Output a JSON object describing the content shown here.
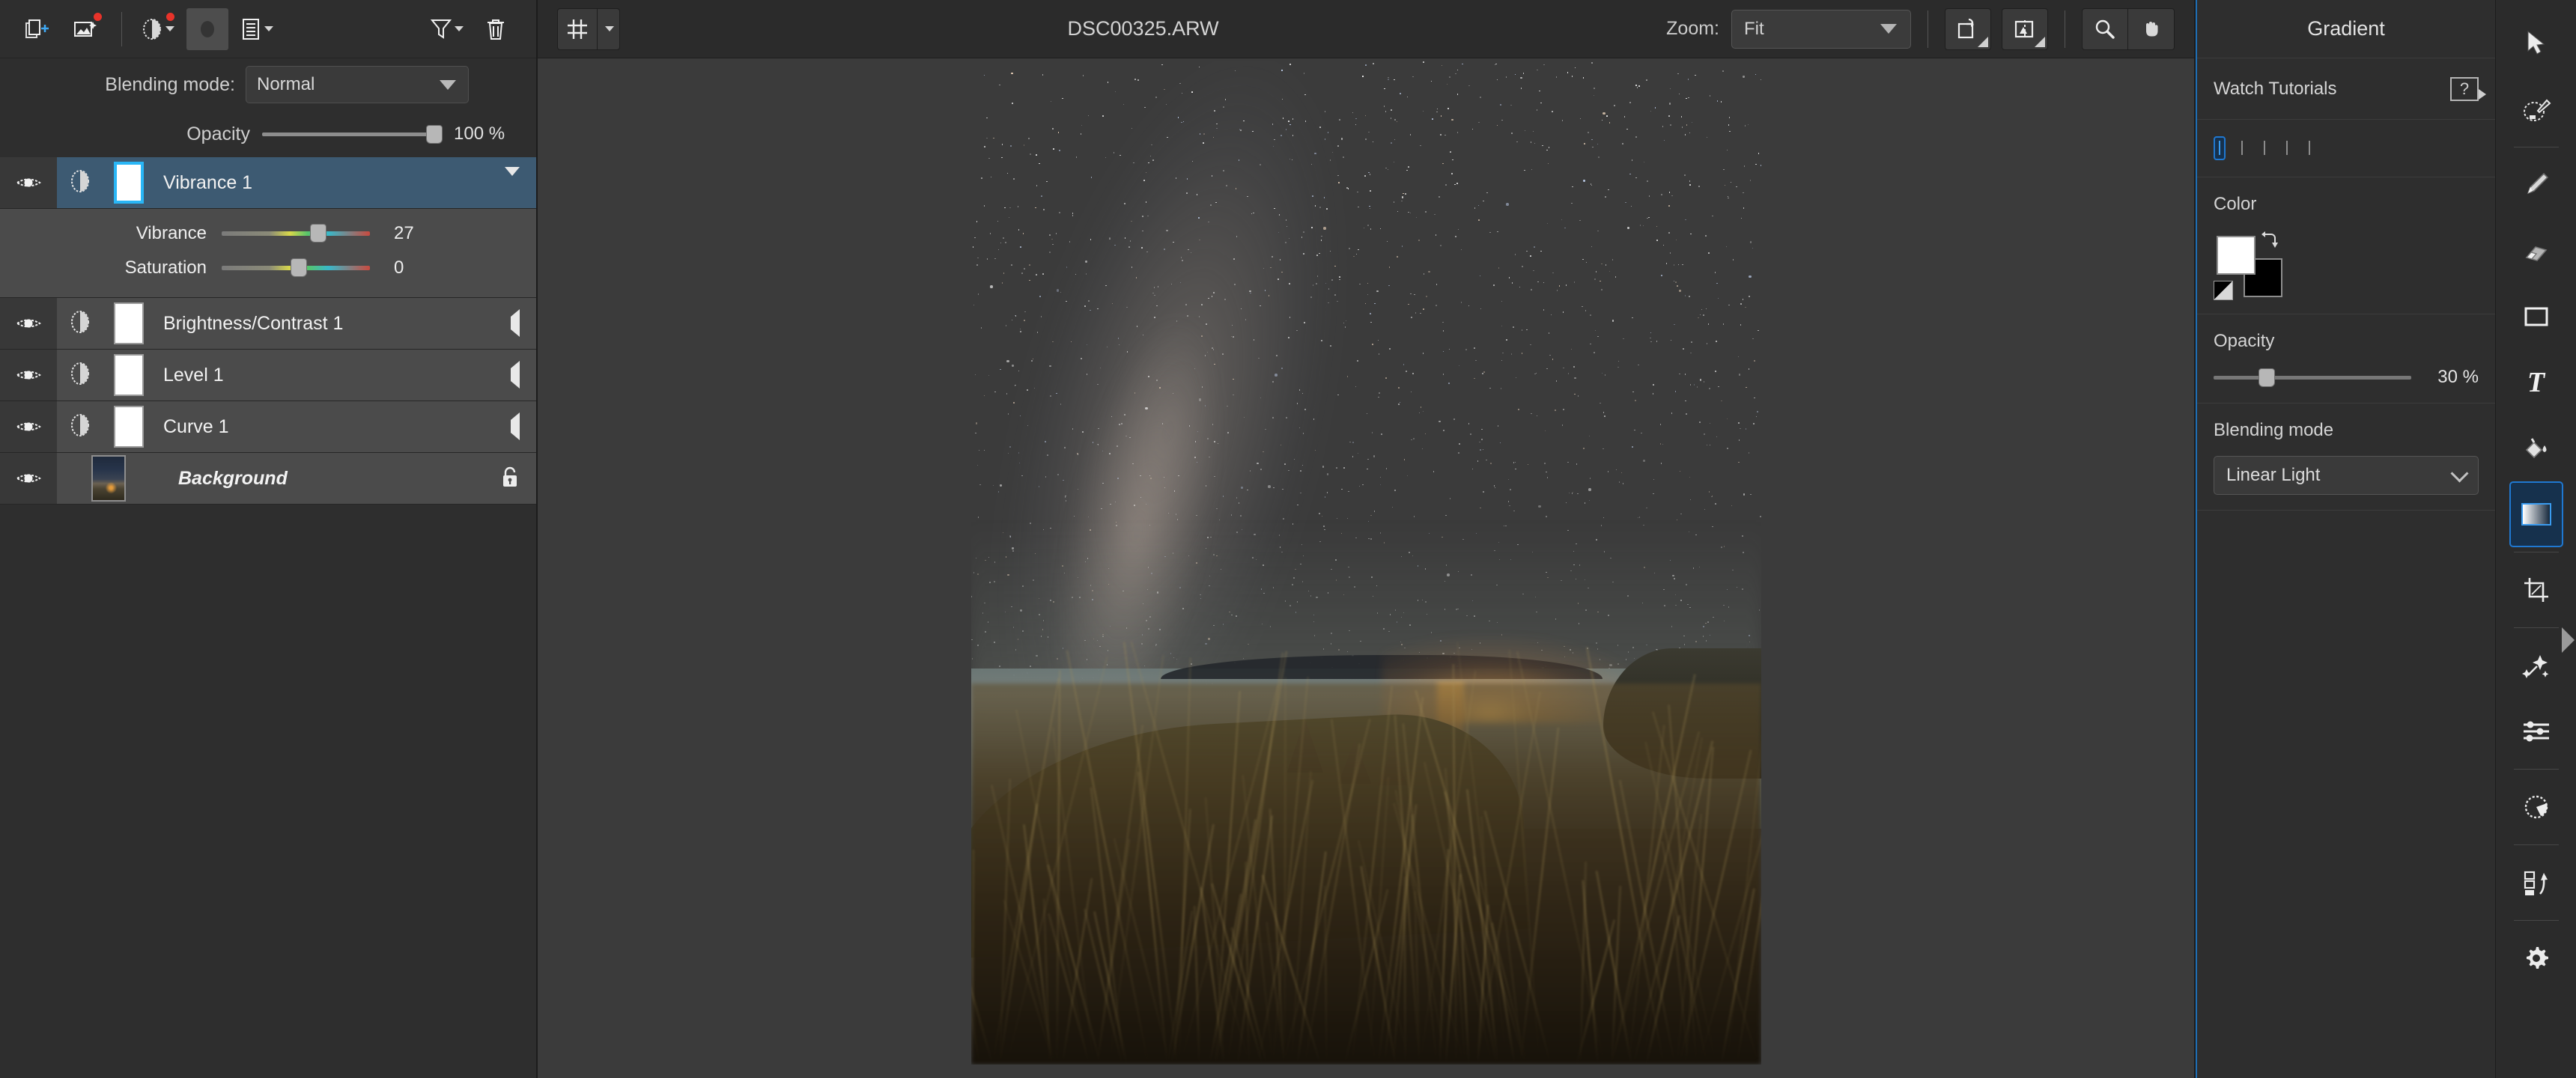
{
  "layers_toolbar": {
    "buttons": [
      {
        "name": "add-layer-button",
        "icon": "add-layer-icon",
        "badge": false
      },
      {
        "name": "add-image-layer-button",
        "icon": "add-image-layer-icon",
        "badge": true
      },
      {
        "name": "add-adjustment-button",
        "icon": "adjustment-circle-icon",
        "badge": true
      },
      {
        "name": "add-mask-button",
        "icon": "mask-icon",
        "badge": false
      },
      {
        "name": "layer-properties-button",
        "icon": "list-lines-icon",
        "badge": false
      },
      {
        "name": "filter-layers-button",
        "icon": "funnel-icon",
        "badge": false
      },
      {
        "name": "delete-layer-button",
        "icon": "trash-icon",
        "badge": false
      }
    ]
  },
  "layer_properties": {
    "blending_mode_label": "Blending mode:",
    "blending_mode_value": "Normal",
    "opacity_label": "Opacity",
    "opacity_value": "100 %",
    "opacity_percent": 100
  },
  "layers": [
    {
      "name": "Vibrance 1",
      "type": "adjustment",
      "selected": true,
      "visible": true,
      "expanded": true,
      "mask_selected": true,
      "params": [
        {
          "label": "Vibrance",
          "value": "27",
          "percent": 63
        },
        {
          "label": "Saturation",
          "value": "0",
          "percent": 50
        }
      ]
    },
    {
      "name": "Brightness/Contrast 1",
      "type": "adjustment",
      "selected": false,
      "visible": true,
      "expanded": false
    },
    {
      "name": "Level 1",
      "type": "adjustment",
      "selected": false,
      "visible": true,
      "expanded": false
    },
    {
      "name": "Curve 1",
      "type": "adjustment",
      "selected": false,
      "visible": true,
      "expanded": false
    },
    {
      "name": "Background",
      "type": "image",
      "selected": false,
      "visible": true,
      "locked": true,
      "italic": true
    }
  ],
  "canvas_toolbar": {
    "grid_button": "grid-icon",
    "document_title": "DSC00325.ARW",
    "zoom_label": "Zoom:",
    "zoom_value": "Fit",
    "rotate_button": "rotate-canvas-icon",
    "flip_button": "flip-canvas-icon",
    "magnifier_button": "magnifier-icon",
    "hand_button": "hand-icon"
  },
  "gradient_panel": {
    "title": "Gradient",
    "tutorials_label": "Watch Tutorials",
    "help_glyph": "?",
    "types": [
      {
        "name": "gradient-type-linear",
        "selected": true
      },
      {
        "name": "gradient-type-radial",
        "selected": false
      },
      {
        "name": "gradient-type-angle",
        "selected": false
      },
      {
        "name": "gradient-type-reflected",
        "selected": false
      },
      {
        "name": "gradient-type-diamond",
        "selected": false
      }
    ],
    "color_label": "Color",
    "foreground_color": "#ffffff",
    "background_color": "#000000",
    "opacity_label": "Opacity",
    "opacity_value": "30 %",
    "opacity_percent": 30,
    "blending_mode_label": "Blending mode",
    "blending_mode_value": "Linear Light"
  },
  "tool_strip": [
    {
      "name": "move-tool",
      "icon": "cursor-arrow-icon",
      "selected": false
    },
    {
      "name": "magic-wand-select-tool",
      "icon": "magic-wand-select-icon",
      "selected": false
    },
    {
      "divider": true
    },
    {
      "name": "pencil-tool",
      "icon": "pencil-icon",
      "selected": false
    },
    {
      "name": "eraser-tool",
      "icon": "eraser-icon",
      "selected": false
    },
    {
      "name": "shape-tool",
      "icon": "rectangle-icon",
      "selected": false
    },
    {
      "name": "text-tool",
      "icon": "text-t-icon",
      "selected": false
    },
    {
      "name": "paint-bucket-tool",
      "icon": "paint-bucket-icon",
      "selected": false
    },
    {
      "name": "gradient-tool",
      "icon": "gradient-icon",
      "selected": true
    },
    {
      "divider": true
    },
    {
      "name": "crop-tool",
      "icon": "crop-icon",
      "selected": false
    },
    {
      "divider": true
    },
    {
      "name": "effects-tool",
      "icon": "sparkle-wand-icon",
      "selected": false
    },
    {
      "name": "adjustments-tool",
      "icon": "sliders-icon",
      "selected": false
    },
    {
      "divider": true
    },
    {
      "name": "color-adjust-tool",
      "icon": "pie-circle-icon",
      "selected": false
    },
    {
      "divider": true
    },
    {
      "name": "export-layers-tool",
      "icon": "layers-export-icon",
      "selected": false
    },
    {
      "divider": true
    },
    {
      "name": "settings-tool",
      "icon": "gear-icon",
      "selected": false
    }
  ],
  "photo": {
    "subject": "milky-way-over-coastal-headland",
    "alt": "Night sky with Milky Way over a sea cliff headland and distant town lights"
  }
}
